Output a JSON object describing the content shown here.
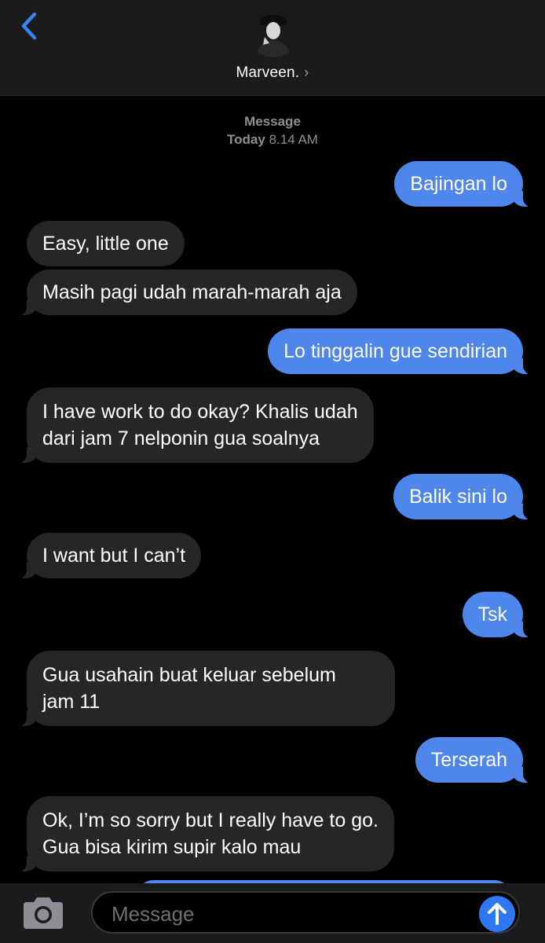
{
  "header": {
    "contact_name": "Marveen.",
    "chevron": "›",
    "back_icon": "chevron-left-icon",
    "avatar": "contact-avatar"
  },
  "meta": {
    "label": "Message",
    "day": "Today",
    "time": "8.14 AM"
  },
  "messages": [
    {
      "sender": "me",
      "text": "Bajingan lo"
    },
    {
      "sender": "them",
      "text": "Easy, little one"
    },
    {
      "sender": "them",
      "text": "Masih pagi udah marah-marah aja"
    },
    {
      "sender": "me",
      "text": "Lo tinggalin gue sendirian"
    },
    {
      "sender": "them",
      "lines": [
        "I have work to do okay? Khalis udah",
        "dari jam 7 nelponin gua soalnya"
      ]
    },
    {
      "sender": "me",
      "text": "Balik sini lo"
    },
    {
      "sender": "them",
      "text": "I want but I can’t"
    },
    {
      "sender": "me",
      "text": "Tsk"
    },
    {
      "sender": "them",
      "lines": [
        "Gua usahain buat keluar sebelum",
        "jam 11"
      ]
    },
    {
      "sender": "me",
      "text": "Terserah"
    },
    {
      "sender": "them",
      "lines": [
        "Ok, I’m so sorry but I really have to go.",
        "Gua bisa kirim supir kalo mau"
      ]
    }
  ],
  "composer": {
    "placeholder": "Message",
    "camera_icon": "camera-icon",
    "send_icon": "arrow-up-icon"
  },
  "colors": {
    "outgoing": "#4f86ec",
    "incoming": "#262628",
    "background": "#000000",
    "bar": "#1b1b1d"
  }
}
